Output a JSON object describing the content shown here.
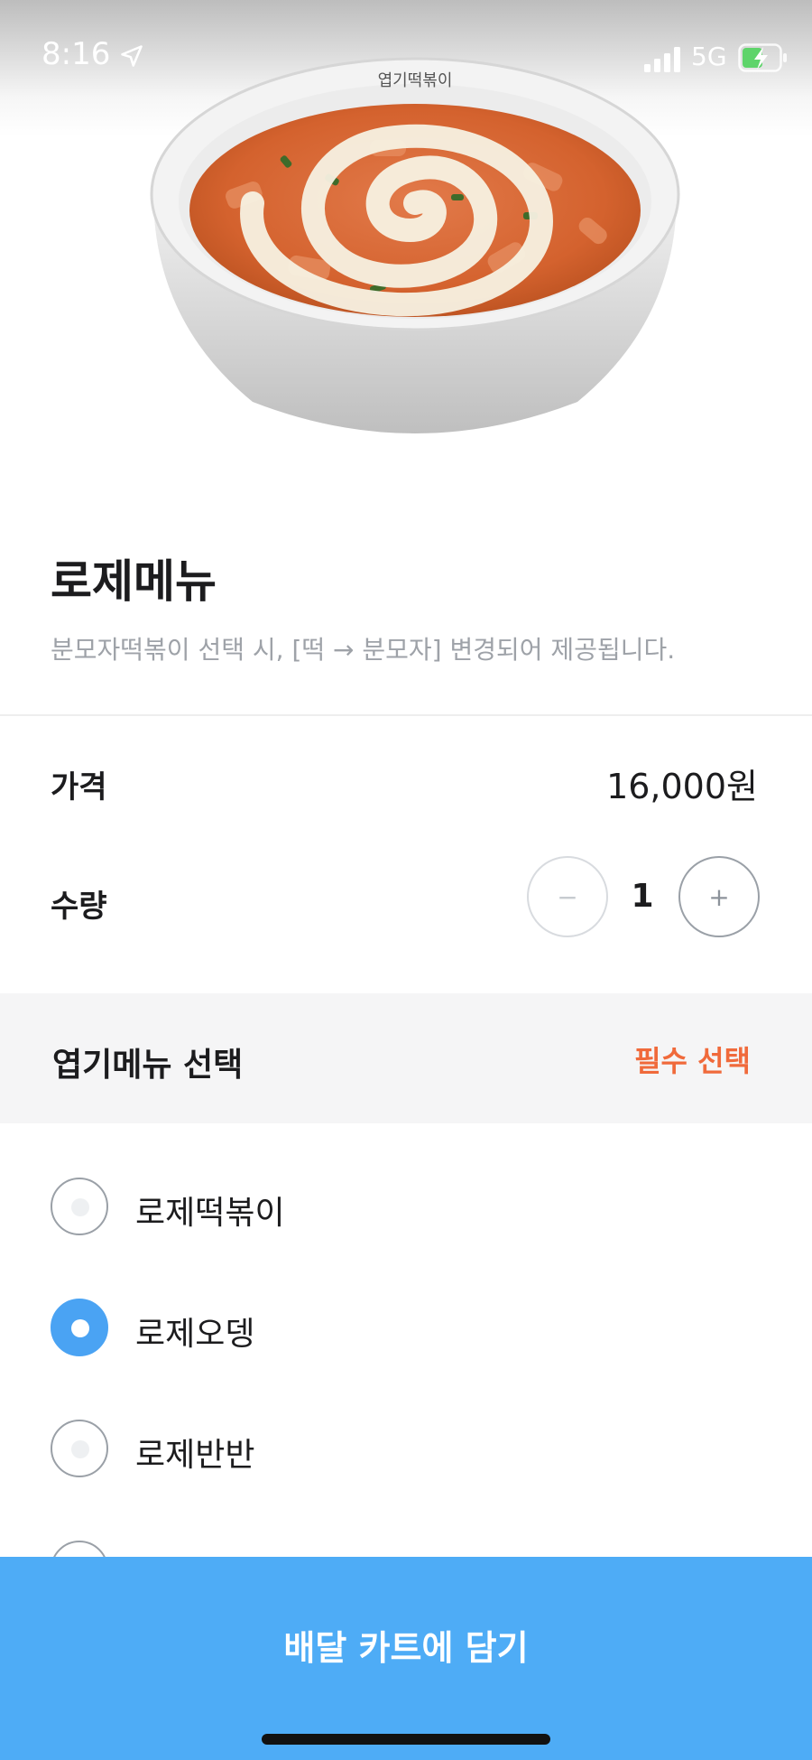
{
  "status_bar": {
    "time": "8:16",
    "network": "5G"
  },
  "hero": {
    "image": "rose-tteokbokki-bowl",
    "bowl_logo": "엽기떡볶이"
  },
  "menu": {
    "title": "로제메뉴",
    "description": "분모자떡볶이 선택 시, [떡 → 분모자] 변경되어 제공됩니다."
  },
  "price": {
    "label": "가격",
    "value": "16,000원"
  },
  "quantity": {
    "label": "수량",
    "minus": "−",
    "plus": "+",
    "value": "1"
  },
  "option_group": {
    "title": "엽기메뉴 선택",
    "required_label": "필수 선택",
    "options": [
      {
        "label": "로제떡볶이",
        "selected": false
      },
      {
        "label": "로제오뎅",
        "selected": true
      },
      {
        "label": "로제반반",
        "selected": false
      }
    ]
  },
  "cta": {
    "label": "배달 카트에 담기"
  },
  "colors": {
    "accent": "#4eacf6",
    "radio_selected": "#4aa3f3",
    "required": "#f06a3b",
    "muted_text": "#9ea2a8"
  }
}
